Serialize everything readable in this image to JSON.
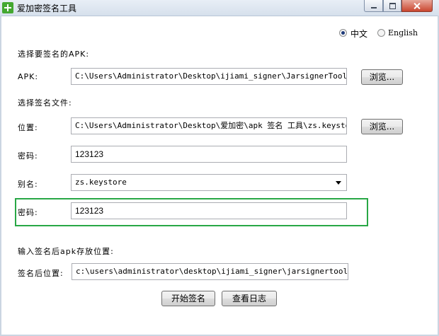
{
  "window": {
    "title": "爱加密签名工具"
  },
  "language": {
    "option_zh": "中文",
    "option_en": "English",
    "selected": "中文"
  },
  "section_apk": {
    "heading": "选择要签名的APK:",
    "label": "APK:",
    "path": "C:\\Users\\Administrator\\Desktop\\ijiami_signer\\JarsignerTool.exe",
    "browse": "浏览..."
  },
  "section_sign": {
    "heading": "选择签名文件:",
    "location_label": "位置:",
    "location_path": "C:\\Users\\Administrator\\Desktop\\爱加密\\apk 签名 工具\\zs.keystore",
    "browse": "浏览...",
    "password_label": "密码:",
    "password_value": "123123",
    "alias_label": "别名:",
    "alias_value": "zs.keystore",
    "alias_password_label": "密码:",
    "alias_password_value": "123123"
  },
  "section_output": {
    "heading": "输入签名后apk存放位置:",
    "label": "签名后位置:",
    "path": "c:\\users\\administrator\\desktop\\ijiami_signer\\jarsignertool.exe"
  },
  "actions": {
    "start": "开始签名",
    "log": "查看日志"
  }
}
